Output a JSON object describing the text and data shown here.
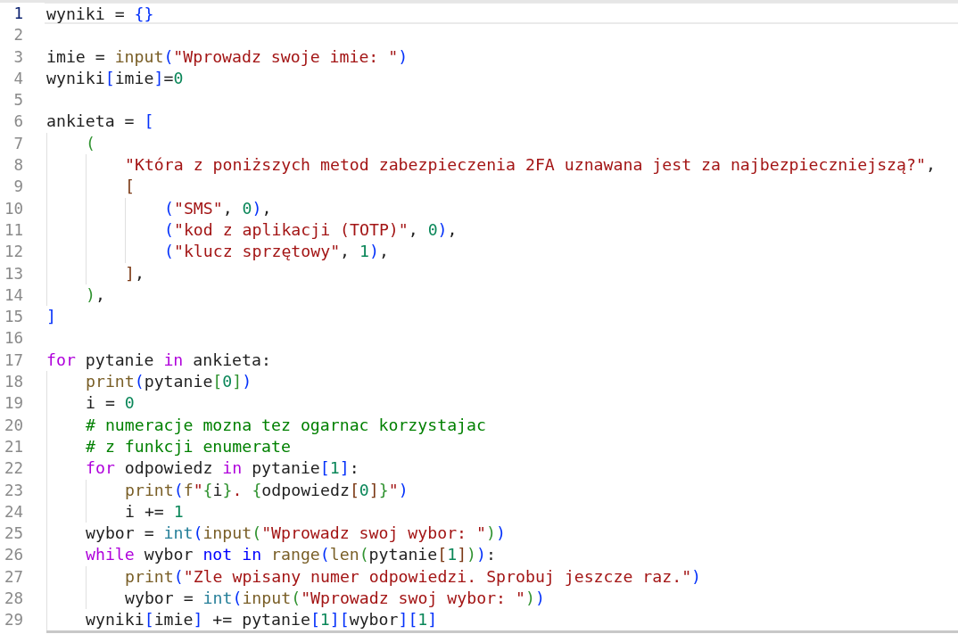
{
  "editor": {
    "lines": [
      {
        "number": "1",
        "active": true,
        "tokens": [
          {
            "text": "wyniki = ",
            "kind": "plain"
          },
          {
            "text": "{}",
            "kind": "bracket1"
          }
        ]
      },
      {
        "number": "2",
        "active": false
      },
      {
        "number": "3",
        "active": false,
        "tokens": [
          {
            "text": "imie = ",
            "kind": "plain"
          },
          {
            "text": "input",
            "kind": "function"
          },
          {
            "text": "(",
            "kind": "bracket1"
          },
          {
            "text": "\"Wprowadz swoje imie: \"",
            "kind": "string"
          },
          {
            "text": ")",
            "kind": "bracket1"
          }
        ]
      },
      {
        "number": "4",
        "active": false,
        "tokens": [
          {
            "text": "wyniki",
            "kind": "plain"
          },
          {
            "text": "[",
            "kind": "bracket1"
          },
          {
            "text": "imie",
            "kind": "plain"
          },
          {
            "text": "]",
            "kind": "bracket1"
          },
          {
            "text": "=",
            "kind": "plain"
          },
          {
            "text": "0",
            "kind": "number"
          }
        ]
      },
      {
        "number": "5",
        "active": false
      },
      {
        "number": "6",
        "active": false,
        "tokens": [
          {
            "text": "ankieta = ",
            "kind": "plain"
          },
          {
            "text": "[",
            "kind": "bracket1"
          }
        ],
        "children": [
          {
            "number": "7",
            "active": false,
            "tokens": [
              {
                "text": "(",
                "kind": "bracket2"
              }
            ],
            "children": [
              {
                "number": "8",
                "active": false,
                "tokens": [
                  {
                    "text": "\"Która z poniższych metod zabezpieczenia 2FA uznawana jest za najbezpieczniejszą?\"",
                    "kind": "string"
                  },
                  {
                    "text": ",",
                    "kind": "plain"
                  }
                ]
              },
              {
                "number": "9",
                "active": false,
                "tokens": [
                  {
                    "text": "[",
                    "kind": "bracket3"
                  }
                ],
                "children": [
                  {
                    "number": "10",
                    "active": false,
                    "tokens": [
                      {
                        "text": "(",
                        "kind": "bracket1"
                      },
                      {
                        "text": "\"SMS\"",
                        "kind": "string"
                      },
                      {
                        "text": ", ",
                        "kind": "plain"
                      },
                      {
                        "text": "0",
                        "kind": "number"
                      },
                      {
                        "text": ")",
                        "kind": "bracket1"
                      },
                      {
                        "text": ",",
                        "kind": "plain"
                      }
                    ]
                  },
                  {
                    "number": "11",
                    "active": false,
                    "tokens": [
                      {
                        "text": "(",
                        "kind": "bracket1"
                      },
                      {
                        "text": "\"kod z aplikacji (TOTP)\"",
                        "kind": "string"
                      },
                      {
                        "text": ", ",
                        "kind": "plain"
                      },
                      {
                        "text": "0",
                        "kind": "number"
                      },
                      {
                        "text": ")",
                        "kind": "bracket1"
                      },
                      {
                        "text": ",",
                        "kind": "plain"
                      }
                    ]
                  },
                  {
                    "number": "12",
                    "active": false,
                    "tokens": [
                      {
                        "text": "(",
                        "kind": "bracket1"
                      },
                      {
                        "text": "\"klucz sprzętowy\"",
                        "kind": "string"
                      },
                      {
                        "text": ", ",
                        "kind": "plain"
                      },
                      {
                        "text": "1",
                        "kind": "number"
                      },
                      {
                        "text": ")",
                        "kind": "bracket1"
                      },
                      {
                        "text": ",",
                        "kind": "plain"
                      }
                    ]
                  }
                ]
              },
              {
                "number": "13",
                "active": false,
                "tokens": [
                  {
                    "text": "]",
                    "kind": "bracket3"
                  },
                  {
                    "text": ",",
                    "kind": "plain"
                  }
                ]
              }
            ]
          },
          {
            "number": "14",
            "active": false,
            "tokens": [
              {
                "text": ")",
                "kind": "bracket2"
              },
              {
                "text": ",",
                "kind": "plain"
              }
            ]
          }
        ]
      },
      {
        "number": "15",
        "active": false,
        "tokens": [
          {
            "text": "]",
            "kind": "bracket1"
          }
        ]
      },
      {
        "number": "16",
        "active": false
      },
      {
        "number": "17",
        "active": false,
        "tokens": [
          {
            "text": "for",
            "kind": "keyword"
          },
          {
            "text": " pytanie ",
            "kind": "plain"
          },
          {
            "text": "in",
            "kind": "keyword"
          },
          {
            "text": " ankieta:",
            "kind": "plain"
          }
        ],
        "children": [
          {
            "number": "18",
            "active": false,
            "tokens": [
              {
                "text": "print",
                "kind": "function"
              },
              {
                "text": "(",
                "kind": "bracket1"
              },
              {
                "text": "pytanie",
                "kind": "plain"
              },
              {
                "text": "[",
                "kind": "bracket2"
              },
              {
                "text": "0",
                "kind": "number"
              },
              {
                "text": "]",
                "kind": "bracket2"
              },
              {
                "text": ")",
                "kind": "bracket1"
              }
            ]
          },
          {
            "number": "19",
            "active": false,
            "tokens": [
              {
                "text": "i = ",
                "kind": "plain"
              },
              {
                "text": "0",
                "kind": "number"
              }
            ]
          },
          {
            "number": "20",
            "active": false,
            "tokens": [
              {
                "text": "# numeracje mozna tez ogarnac korzystajac",
                "kind": "comment"
              }
            ]
          },
          {
            "number": "21",
            "active": false,
            "tokens": [
              {
                "text": "# z funkcji enumerate",
                "kind": "comment"
              }
            ]
          },
          {
            "number": "22",
            "active": false,
            "tokens": [
              {
                "text": "for",
                "kind": "keyword"
              },
              {
                "text": " odpowiedz ",
                "kind": "plain"
              },
              {
                "text": "in",
                "kind": "keyword"
              },
              {
                "text": " pytanie",
                "kind": "plain"
              },
              {
                "text": "[",
                "kind": "bracket1"
              },
              {
                "text": "1",
                "kind": "number"
              },
              {
                "text": "]",
                "kind": "bracket1"
              },
              {
                "text": ":",
                "kind": "plain"
              }
            ],
            "children": [
              {
                "number": "23",
                "active": false,
                "tokens": [
                  {
                    "text": "print",
                    "kind": "function"
                  },
                  {
                    "text": "(",
                    "kind": "bracket1"
                  },
                  {
                    "text": "f",
                    "kind": "function"
                  },
                  {
                    "text": "\"",
                    "kind": "string"
                  },
                  {
                    "text": "{",
                    "kind": "bracket2"
                  },
                  {
                    "text": "i",
                    "kind": "plain"
                  },
                  {
                    "text": "}",
                    "kind": "bracket2"
                  },
                  {
                    "text": ". ",
                    "kind": "string"
                  },
                  {
                    "text": "{",
                    "kind": "bracket2"
                  },
                  {
                    "text": "odpowiedz",
                    "kind": "plain"
                  },
                  {
                    "text": "[",
                    "kind": "bracket3"
                  },
                  {
                    "text": "0",
                    "kind": "number"
                  },
                  {
                    "text": "]",
                    "kind": "bracket3"
                  },
                  {
                    "text": "}",
                    "kind": "bracket2"
                  },
                  {
                    "text": "\"",
                    "kind": "string"
                  },
                  {
                    "text": ")",
                    "kind": "bracket1"
                  }
                ]
              },
              {
                "number": "24",
                "active": false,
                "tokens": [
                  {
                    "text": "i += ",
                    "kind": "plain"
                  },
                  {
                    "text": "1",
                    "kind": "number"
                  }
                ]
              }
            ]
          },
          {
            "number": "25",
            "active": false,
            "tokens": [
              {
                "text": "wybor = ",
                "kind": "plain"
              },
              {
                "text": "int",
                "kind": "type"
              },
              {
                "text": "(",
                "kind": "bracket1"
              },
              {
                "text": "input",
                "kind": "function"
              },
              {
                "text": "(",
                "kind": "bracket2"
              },
              {
                "text": "\"Wprowadz swoj wybor: \"",
                "kind": "string"
              },
              {
                "text": ")",
                "kind": "bracket2"
              },
              {
                "text": ")",
                "kind": "bracket1"
              }
            ]
          },
          {
            "number": "26",
            "active": false,
            "tokens": [
              {
                "text": "while",
                "kind": "keyword"
              },
              {
                "text": " wybor ",
                "kind": "plain"
              },
              {
                "text": "not in ",
                "kind": "operator"
              },
              {
                "text": "range",
                "kind": "function"
              },
              {
                "text": "(",
                "kind": "bracket1"
              },
              {
                "text": "len",
                "kind": "function"
              },
              {
                "text": "(",
                "kind": "bracket2"
              },
              {
                "text": "pytanie",
                "kind": "plain"
              },
              {
                "text": "[",
                "kind": "bracket3"
              },
              {
                "text": "1",
                "kind": "number"
              },
              {
                "text": "]",
                "kind": "bracket3"
              },
              {
                "text": ")",
                "kind": "bracket2"
              },
              {
                "text": ")",
                "kind": "bracket1"
              },
              {
                "text": ":",
                "kind": "plain"
              }
            ],
            "children": [
              {
                "number": "27",
                "active": false,
                "tokens": [
                  {
                    "text": "print",
                    "kind": "function"
                  },
                  {
                    "text": "(",
                    "kind": "bracket1"
                  },
                  {
                    "text": "\"Zle wpisany numer odpowiedzi. Sprobuj jeszcze raz.\"",
                    "kind": "string"
                  },
                  {
                    "text": ")",
                    "kind": "bracket1"
                  }
                ]
              },
              {
                "number": "28",
                "active": false,
                "tokens": [
                  {
                    "text": "wybor = ",
                    "kind": "plain"
                  },
                  {
                    "text": "int",
                    "kind": "type"
                  },
                  {
                    "text": "(",
                    "kind": "bracket1"
                  },
                  {
                    "text": "input",
                    "kind": "function"
                  },
                  {
                    "text": "(",
                    "kind": "bracket2"
                  },
                  {
                    "text": "\"Wprowadz swoj wybor: \"",
                    "kind": "string"
                  },
                  {
                    "text": ")",
                    "kind": "bracket2"
                  },
                  {
                    "text": ")",
                    "kind": "bracket1"
                  }
                ]
              }
            ]
          },
          {
            "number": "29",
            "active": false,
            "tokens": [
              {
                "text": "wyniki",
                "kind": "plain"
              },
              {
                "text": "[",
                "kind": "bracket1"
              },
              {
                "text": "imie",
                "kind": "plain"
              },
              {
                "text": "]",
                "kind": "bracket1"
              },
              {
                "text": " += pytanie",
                "kind": "plain"
              },
              {
                "text": "[",
                "kind": "bracket1"
              },
              {
                "text": "1",
                "kind": "number"
              },
              {
                "text": "]",
                "kind": "bracket1"
              },
              {
                "text": "[",
                "kind": "bracket1"
              },
              {
                "text": "wybor",
                "kind": "plain"
              },
              {
                "text": "]",
                "kind": "bracket1"
              },
              {
                "text": "[",
                "kind": "bracket1"
              },
              {
                "text": "1",
                "kind": "number"
              },
              {
                "text": "]",
                "kind": "bracket1"
              }
            ]
          }
        ]
      }
    ]
  }
}
